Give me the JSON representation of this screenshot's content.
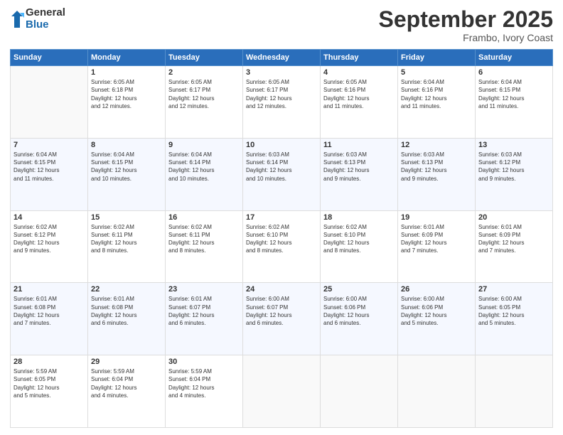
{
  "header": {
    "logo": {
      "general": "General",
      "blue": "Blue"
    },
    "title": "September 2025",
    "subtitle": "Frambo, Ivory Coast"
  },
  "weekdays": [
    "Sunday",
    "Monday",
    "Tuesday",
    "Wednesday",
    "Thursday",
    "Friday",
    "Saturday"
  ],
  "weeks": [
    [
      {
        "day": "",
        "info": ""
      },
      {
        "day": "1",
        "info": "Sunrise: 6:05 AM\nSunset: 6:18 PM\nDaylight: 12 hours\nand 12 minutes."
      },
      {
        "day": "2",
        "info": "Sunrise: 6:05 AM\nSunset: 6:17 PM\nDaylight: 12 hours\nand 12 minutes."
      },
      {
        "day": "3",
        "info": "Sunrise: 6:05 AM\nSunset: 6:17 PM\nDaylight: 12 hours\nand 12 minutes."
      },
      {
        "day": "4",
        "info": "Sunrise: 6:05 AM\nSunset: 6:16 PM\nDaylight: 12 hours\nand 11 minutes."
      },
      {
        "day": "5",
        "info": "Sunrise: 6:04 AM\nSunset: 6:16 PM\nDaylight: 12 hours\nand 11 minutes."
      },
      {
        "day": "6",
        "info": "Sunrise: 6:04 AM\nSunset: 6:15 PM\nDaylight: 12 hours\nand 11 minutes."
      }
    ],
    [
      {
        "day": "7",
        "info": "Sunrise: 6:04 AM\nSunset: 6:15 PM\nDaylight: 12 hours\nand 11 minutes."
      },
      {
        "day": "8",
        "info": "Sunrise: 6:04 AM\nSunset: 6:15 PM\nDaylight: 12 hours\nand 10 minutes."
      },
      {
        "day": "9",
        "info": "Sunrise: 6:04 AM\nSunset: 6:14 PM\nDaylight: 12 hours\nand 10 minutes."
      },
      {
        "day": "10",
        "info": "Sunrise: 6:03 AM\nSunset: 6:14 PM\nDaylight: 12 hours\nand 10 minutes."
      },
      {
        "day": "11",
        "info": "Sunrise: 6:03 AM\nSunset: 6:13 PM\nDaylight: 12 hours\nand 9 minutes."
      },
      {
        "day": "12",
        "info": "Sunrise: 6:03 AM\nSunset: 6:13 PM\nDaylight: 12 hours\nand 9 minutes."
      },
      {
        "day": "13",
        "info": "Sunrise: 6:03 AM\nSunset: 6:12 PM\nDaylight: 12 hours\nand 9 minutes."
      }
    ],
    [
      {
        "day": "14",
        "info": "Sunrise: 6:02 AM\nSunset: 6:12 PM\nDaylight: 12 hours\nand 9 minutes."
      },
      {
        "day": "15",
        "info": "Sunrise: 6:02 AM\nSunset: 6:11 PM\nDaylight: 12 hours\nand 8 minutes."
      },
      {
        "day": "16",
        "info": "Sunrise: 6:02 AM\nSunset: 6:11 PM\nDaylight: 12 hours\nand 8 minutes."
      },
      {
        "day": "17",
        "info": "Sunrise: 6:02 AM\nSunset: 6:10 PM\nDaylight: 12 hours\nand 8 minutes."
      },
      {
        "day": "18",
        "info": "Sunrise: 6:02 AM\nSunset: 6:10 PM\nDaylight: 12 hours\nand 8 minutes."
      },
      {
        "day": "19",
        "info": "Sunrise: 6:01 AM\nSunset: 6:09 PM\nDaylight: 12 hours\nand 7 minutes."
      },
      {
        "day": "20",
        "info": "Sunrise: 6:01 AM\nSunset: 6:09 PM\nDaylight: 12 hours\nand 7 minutes."
      }
    ],
    [
      {
        "day": "21",
        "info": "Sunrise: 6:01 AM\nSunset: 6:08 PM\nDaylight: 12 hours\nand 7 minutes."
      },
      {
        "day": "22",
        "info": "Sunrise: 6:01 AM\nSunset: 6:08 PM\nDaylight: 12 hours\nand 6 minutes."
      },
      {
        "day": "23",
        "info": "Sunrise: 6:01 AM\nSunset: 6:07 PM\nDaylight: 12 hours\nand 6 minutes."
      },
      {
        "day": "24",
        "info": "Sunrise: 6:00 AM\nSunset: 6:07 PM\nDaylight: 12 hours\nand 6 minutes."
      },
      {
        "day": "25",
        "info": "Sunrise: 6:00 AM\nSunset: 6:06 PM\nDaylight: 12 hours\nand 6 minutes."
      },
      {
        "day": "26",
        "info": "Sunrise: 6:00 AM\nSunset: 6:06 PM\nDaylight: 12 hours\nand 5 minutes."
      },
      {
        "day": "27",
        "info": "Sunrise: 6:00 AM\nSunset: 6:05 PM\nDaylight: 12 hours\nand 5 minutes."
      }
    ],
    [
      {
        "day": "28",
        "info": "Sunrise: 5:59 AM\nSunset: 6:05 PM\nDaylight: 12 hours\nand 5 minutes."
      },
      {
        "day": "29",
        "info": "Sunrise: 5:59 AM\nSunset: 6:04 PM\nDaylight: 12 hours\nand 4 minutes."
      },
      {
        "day": "30",
        "info": "Sunrise: 5:59 AM\nSunset: 6:04 PM\nDaylight: 12 hours\nand 4 minutes."
      },
      {
        "day": "",
        "info": ""
      },
      {
        "day": "",
        "info": ""
      },
      {
        "day": "",
        "info": ""
      },
      {
        "day": "",
        "info": ""
      }
    ]
  ]
}
